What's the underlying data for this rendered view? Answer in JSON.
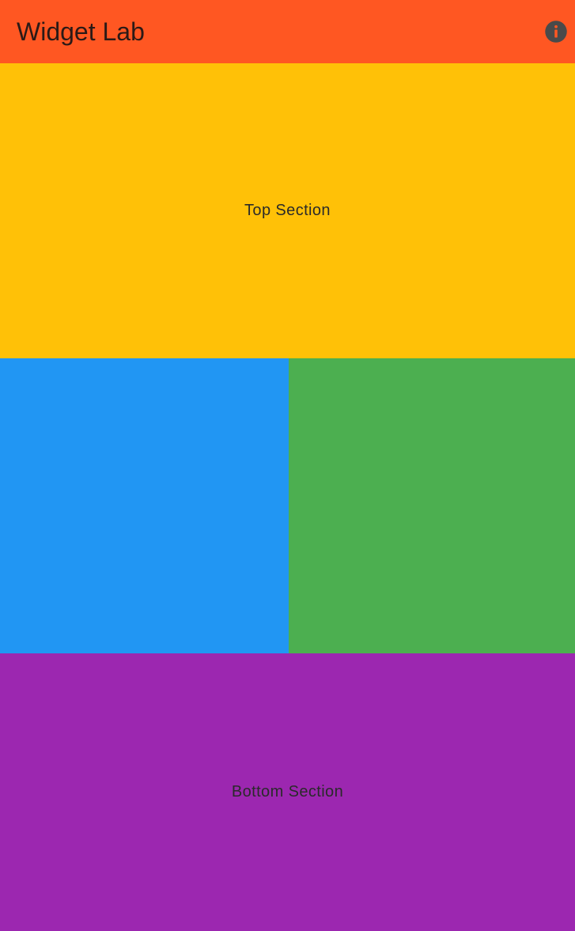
{
  "app_bar": {
    "title": "Widget Lab",
    "background": "#ff5722",
    "action_icon": "info-icon"
  },
  "sections": {
    "top": {
      "label": "Top Section",
      "color": "#ffc107"
    },
    "middle_left": {
      "color": "#2196f3"
    },
    "middle_right": {
      "color": "#4caf50"
    },
    "bottom": {
      "label": "Bottom Section",
      "color": "#9c27b0"
    }
  },
  "icon_color": "#4a4a4a"
}
